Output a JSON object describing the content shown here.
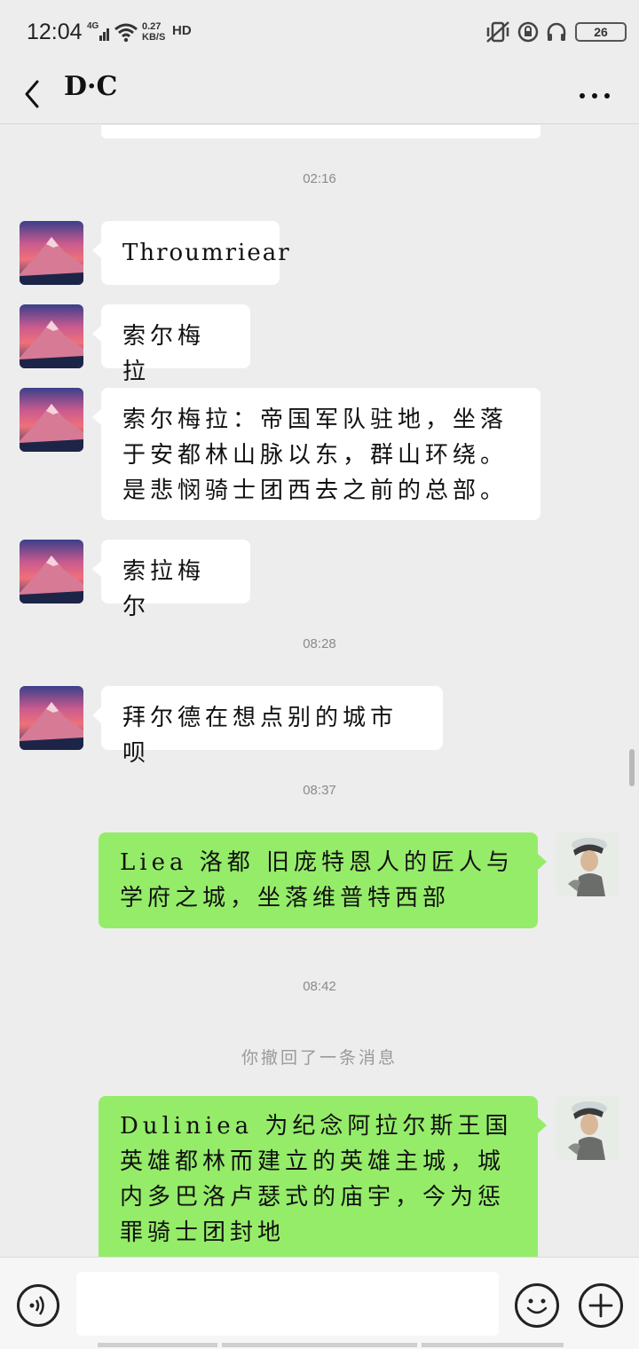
{
  "status": {
    "time": "12:04",
    "network": "4G",
    "speed_value": "0.27",
    "speed_unit": "KB/S",
    "hd": "HD",
    "battery": "26"
  },
  "header": {
    "title": "D·C",
    "back_icon": "chevron-left-icon",
    "more_icon": "more-dots-icon"
  },
  "timestamps": {
    "t1": "02:16",
    "t2": "08:28",
    "t3": "08:37",
    "t4": "08:42"
  },
  "messages": {
    "m1": "Throumriear",
    "m2": "索尔梅拉",
    "m3": "索尔梅拉：帝国军队驻地，坐落于安都林山脉以东，群山环绕。是悲悯骑士团西去之前的总部。",
    "m4": "索拉梅尔",
    "m5": "拜尔德在想点别的城市呗",
    "m6": "Liea 洛都 旧庞特恩人的匠人与学府之城，坐落维普特西部",
    "m7": "Duliniea 为纪念阿拉尔斯王国英雄都林而建立的英雄主城，城内多巴洛卢瑟式的庙宇，今为惩罪骑士团封地"
  },
  "recall_notice": "你撤回了一条消息",
  "input": {
    "value": "",
    "placeholder": ""
  },
  "icons": {
    "voice": "voice-icon",
    "emoji": "emoji-icon",
    "plus": "plus-icon"
  },
  "colors": {
    "outgoing_bubble": "#95ec69",
    "incoming_bubble": "#ffffff",
    "background": "#ededed"
  }
}
